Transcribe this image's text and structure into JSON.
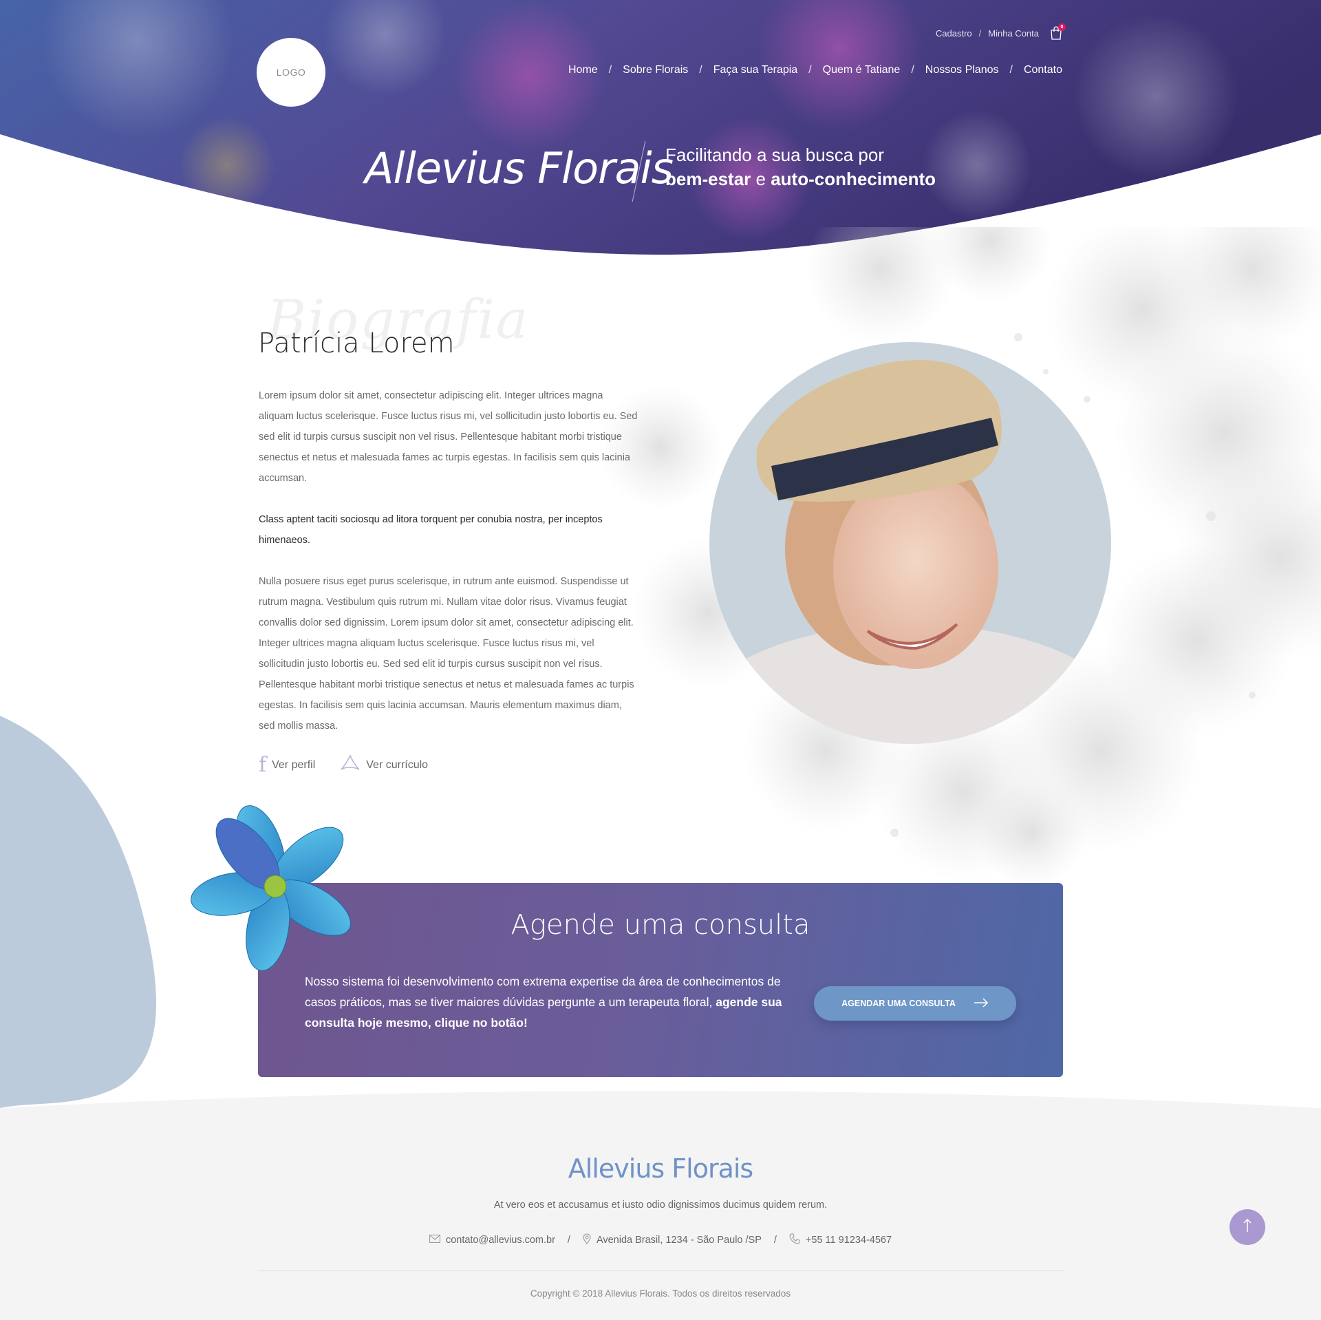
{
  "header": {
    "logo_text": "LOGO",
    "top_links": {
      "register": "Cadastro",
      "separator": "/",
      "account": "Minha Conta",
      "cart_count": "0"
    },
    "nav": {
      "separator": "/",
      "items": [
        "Home",
        "Sobre Florais",
        "Faça sua Terapia",
        "Quem é Tatiane",
        "Nossos Planos",
        "Contato"
      ]
    },
    "brand_title": "Allevius Florais",
    "tagline": {
      "line1": "Facilitando a sua busca por",
      "bold1": "bem-estar",
      "connector": "e",
      "bold2": "auto-conhecimento"
    }
  },
  "bio": {
    "watermark": "Biografia",
    "name": "Patrícia Lorem",
    "paragraphs": [
      "Lorem ipsum dolor sit amet, consectetur adipiscing elit. Integer ultrices magna aliquam luctus scelerisque. Fusce luctus risus mi, vel sollicitudin justo lobortis eu. Sed sed elit id turpis cursus suscipit non vel risus. Pellentesque habitant morbi tristique senectus et netus et malesuada fames ac turpis egestas. In facilisis sem quis lacinia accumsan.",
      "Class aptent taciti sociosqu ad litora torquent per conubia nostra, per inceptos himenaeos.",
      "Nulla posuere risus eget purus scelerisque, in rutrum ante euismod. Suspendisse ut rutrum magna. Vestibulum quis rutrum mi. Nullam vitae dolor risus. Vivamus feugiat convallis dolor sed dignissim. Lorem ipsum dolor sit amet, consectetur adipiscing elit. Integer ultrices magna aliquam luctus scelerisque. Fusce luctus risus mi, vel sollicitudin justo lobortis eu. Sed sed elit id turpis cursus suscipit non vel risus. Pellentesque habitant morbi tristique senectus et netus et malesuada fames ac turpis egestas. In facilisis sem quis lacinia accumsan. Mauris elementum maximus diam, sed mollis massa."
    ],
    "links": {
      "profile": "Ver perfil",
      "resume": "Ver currículo"
    }
  },
  "cta": {
    "title": "Agende uma consulta",
    "text": "Nosso sistema foi desenvolvimento com extrema expertise da área de conhecimentos de casos práticos, mas se tiver maiores dúvidas pergunte a um terapeuta floral,",
    "text_bold": "agende sua consulta hoje mesmo, clique no botão!",
    "button": "AGENDAR UMA CONSULTA"
  },
  "footer": {
    "brand": "Allevius Florais",
    "description": "At vero eos et accusamus et iusto odio dignissimos ducimus quidem rerum.",
    "email": "contato@allevius.com.br",
    "address": "Avenida Brasil, 1234 - São Paulo /SP",
    "phone": "+55 11 91234-4567",
    "separator": "/",
    "copyright": "Copyright © 2018 Allevius Florais. Todos os direitos reservados"
  },
  "colors": {
    "hero_dark": "#3b2f6e",
    "hero_light": "#5b6fb8",
    "accent_purple": "#6f568f",
    "accent_blue": "#4f68a6",
    "footer_brand": "#6f92c8",
    "cart_badge": "#e0185e",
    "to_top": "#a999d0"
  },
  "icons": [
    "cart-icon",
    "facebook-icon",
    "acrobat-icon",
    "arrow-right-icon",
    "mail-icon",
    "location-icon",
    "phone-icon",
    "arrow-up-icon"
  ]
}
